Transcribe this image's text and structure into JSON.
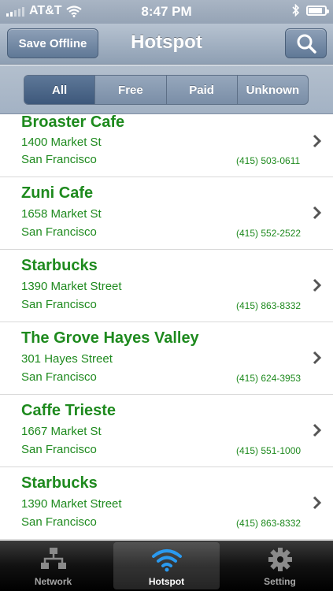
{
  "status_bar": {
    "carrier": "AT&T",
    "time": "8:47 PM",
    "battery_level": 0.85
  },
  "nav": {
    "title": "Hotspot",
    "save_label": "Save Offline",
    "search_icon": "search-icon"
  },
  "filters": {
    "options": [
      "All",
      "Free",
      "Paid",
      "Unknown"
    ],
    "selected": "All"
  },
  "hotspots": [
    {
      "name": "Broaster Cafe",
      "address": "1400 Market St",
      "city": "San Francisco",
      "phone": "(415) 503-0611"
    },
    {
      "name": "Zuni Cafe",
      "address": "1658 Market St",
      "city": "San Francisco",
      "phone": "(415) 552-2522"
    },
    {
      "name": "Starbucks",
      "address": "1390 Market Street",
      "city": "San Francisco",
      "phone": "(415) 863-8332"
    },
    {
      "name": "The Grove Hayes Valley",
      "address": "301 Hayes Street",
      "city": "San Francisco",
      "phone": "(415) 624-3953"
    },
    {
      "name": "Caffe Trieste",
      "address": "1667 Market St",
      "city": "San Francisco",
      "phone": "(415) 551-1000"
    },
    {
      "name": "Starbucks",
      "address": "1390 Market Street",
      "city": "San Francisco",
      "phone": "(415) 863-8332"
    }
  ],
  "tab_bar": {
    "tabs": [
      {
        "label": "Network",
        "icon": "network-icon"
      },
      {
        "label": "Hotspot",
        "icon": "wifi-icon"
      },
      {
        "label": "Setting",
        "icon": "gear-icon"
      }
    ],
    "active": "Hotspot"
  },
  "colors": {
    "accent_green": "#1e8a1e",
    "nav_blue": "#8e9fb3"
  }
}
